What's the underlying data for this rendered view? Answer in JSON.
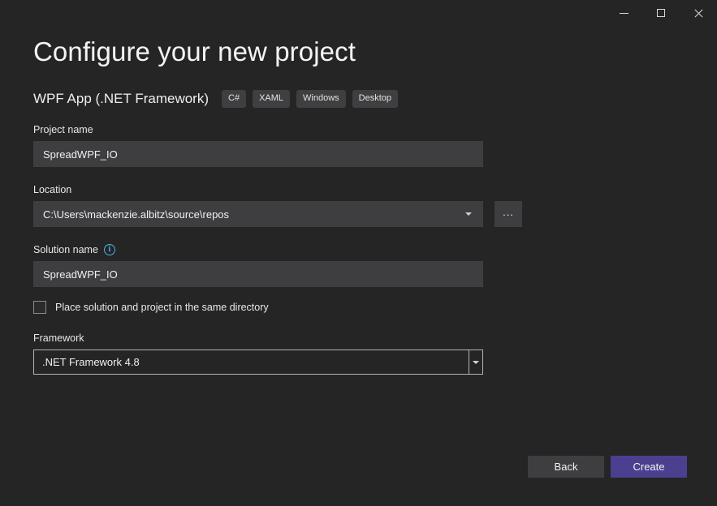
{
  "window": {
    "controls": [
      {
        "name": "minimize",
        "glyph": "minimize-icon",
        "label": "Minimize"
      },
      {
        "name": "maximize",
        "glyph": "maximize-icon",
        "label": "Maximize"
      },
      {
        "name": "close",
        "glyph": "close-icon",
        "label": "Close"
      }
    ]
  },
  "header": {
    "title": "Configure your new project",
    "template_name": "WPF App (.NET Framework)",
    "tags": [
      "C#",
      "XAML",
      "Windows",
      "Desktop"
    ]
  },
  "form": {
    "project_name": {
      "label": "Project name",
      "value": "SpreadWPF_IO",
      "placeholder": ""
    },
    "location": {
      "label": "Location",
      "value": "C:\\Users\\mackenzie.albitz\\source\\repos",
      "placeholder": "",
      "browse_label": "..."
    },
    "solution_name": {
      "label": "Solution name",
      "info_glyph": "i",
      "value": "SpreadWPF_IO",
      "placeholder": ""
    },
    "same_directory": {
      "label": "Place solution and project in the same directory",
      "checked": false
    },
    "framework": {
      "label": "Framework",
      "value": ".NET Framework 4.8"
    }
  },
  "footer": {
    "back_label": "Back",
    "create_label": "Create"
  },
  "colors": {
    "page_background": "#252526",
    "field_background": "#3e3e40",
    "tag_background": "#3f3f41",
    "accent_primary": "#4b3f8f",
    "info_icon": "#4ab4e6",
    "text": "#f1f1f1",
    "combo_border": "#b4b4b4"
  }
}
